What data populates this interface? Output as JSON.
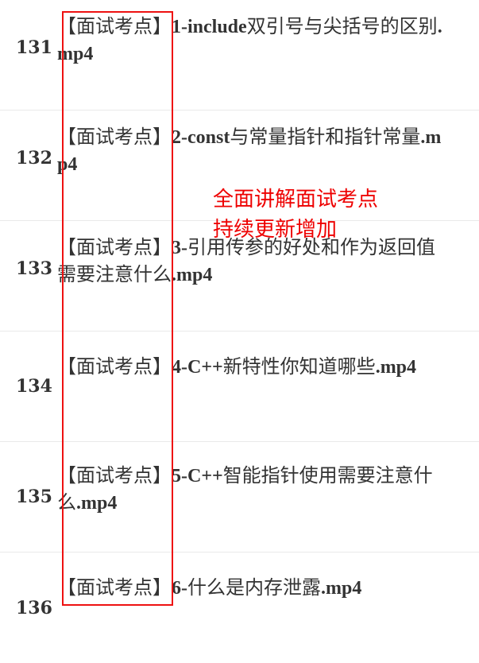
{
  "rows": [
    {
      "num": "131",
      "tag": "【面试考点】",
      "code": "1-include",
      "text": "双引号与尖括号的区别",
      "ext": ".mp4"
    },
    {
      "num": "132",
      "tag": "【面试考点】",
      "code": "2-const",
      "text": "与常量指针和指针常量",
      "ext": ".mp4"
    },
    {
      "num": "133",
      "tag": "【面试考点】",
      "code": "3-",
      "text": "引用传参的好处和作为返回值需要注意什么",
      "ext": ".mp4"
    },
    {
      "num": "134",
      "tag": "【面试考点】",
      "code": "4-C++",
      "text": "新特性你知道哪些",
      "ext": ".mp4"
    },
    {
      "num": "135",
      "tag": "【面试考点】",
      "code": "5-C++",
      "text": "智能指针使用需要注意什么",
      "ext": ".mp4"
    },
    {
      "num": "136",
      "tag": "【面试考点】",
      "code": "6-",
      "text": "什么是内存泄露",
      "ext": ".mp4"
    }
  ],
  "annotation": {
    "line1": "全面讲解面试考点",
    "line2": "持续更新增加"
  },
  "colors": {
    "highlight_box": "#ee1111",
    "annotation_text": "#ee0000",
    "body_text": "#333333",
    "divider": "#e9e9e9"
  }
}
